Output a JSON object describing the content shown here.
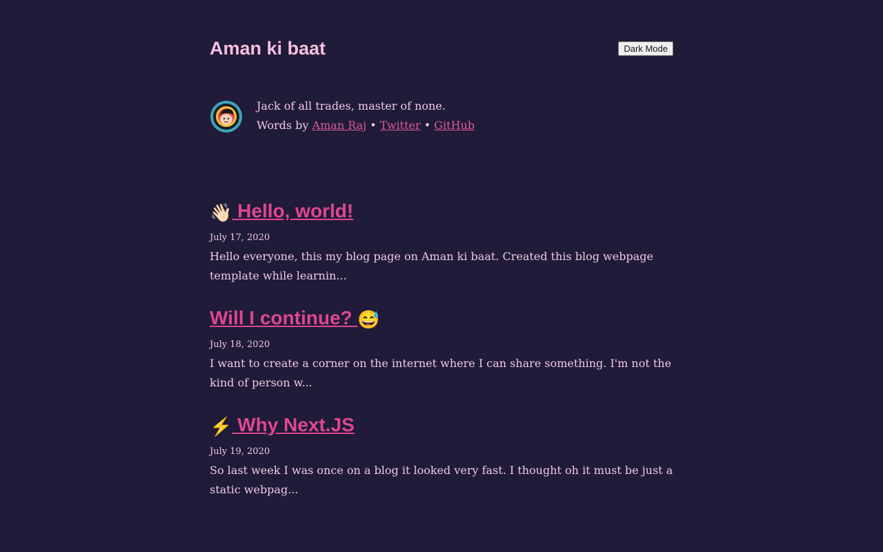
{
  "header": {
    "site_title": "Aman ki baat",
    "mode_button_label": "Dark Mode"
  },
  "bio": {
    "tagline": "Jack of all trades, master of none.",
    "words_by": "Words by ",
    "author_link": "Aman Raj",
    "separator": " • ",
    "twitter_link": " Twitter",
    "github_link": " GitHub"
  },
  "posts": [
    {
      "emoji_prefix": "👋🏻",
      "emoji_suffix": "",
      "title": "Hello, world!",
      "date": "July 17, 2020",
      "excerpt": "Hello everyone, this my blog page on Aman ki baat. Created this blog webpage template while learnin..."
    },
    {
      "emoji_prefix": "",
      "emoji_suffix": "😅",
      "title": "Will I continue?",
      "date": "July 18, 2020",
      "excerpt": "I want to create a corner on the internet where I can share something. I'm not the kind of person w..."
    },
    {
      "emoji_prefix": "⚡",
      "emoji_suffix": "",
      "title": "Why Next.JS",
      "date": "July 19, 2020",
      "excerpt": "So last week I was once on a blog it looked very fast. I thought oh it must be just a static webpag..."
    }
  ],
  "colors": {
    "background": "#1f1b38",
    "text": "#f2c9e3",
    "link": "#e0468f",
    "title": "#f7bfe0"
  }
}
